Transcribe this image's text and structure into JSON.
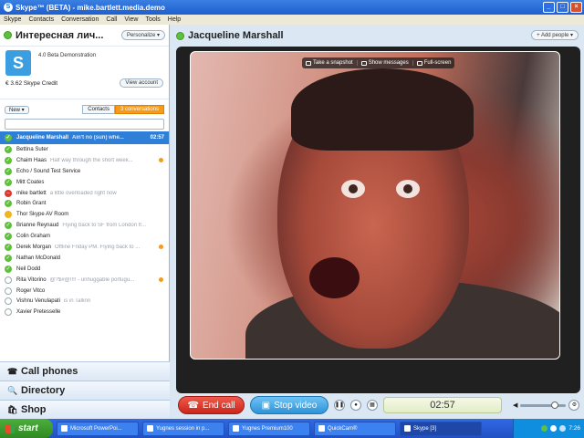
{
  "window": {
    "title": "Skype™ (BETA) - mike.bartlett.media.demo",
    "app_icon": "S",
    "controls": {
      "minimize": "_",
      "maximize": "□",
      "close": "×"
    }
  },
  "menu": [
    "Skype",
    "Contacts",
    "Conversation",
    "Call",
    "View",
    "Tools",
    "Help"
  ],
  "status": {
    "name": "Интересная лич...",
    "personalize_label": "Personalize ▾"
  },
  "profile": {
    "avatar_letter": "S",
    "mood": "4.0 Beta Demonstration",
    "credit": "€ 3.62 Skype Credit",
    "view_account_label": "View account"
  },
  "list_controls": {
    "new_label": "New ▾",
    "tab_contacts": "Contacts",
    "tab_conversations": "3 conversations"
  },
  "contacts": [
    {
      "name": "Jacqueline Marshall",
      "mood": "Ain't no (sun) whe...",
      "time": "02:57",
      "status": "online",
      "selected": true
    },
    {
      "name": "Bettina Suter",
      "mood": "",
      "status": "online"
    },
    {
      "name": "Chaim Haas",
      "mood": "Half way through the short week...",
      "status": "online",
      "flag": true
    },
    {
      "name": "Echo / Sound Test Service",
      "mood": "",
      "status": "online"
    },
    {
      "name": "Mitt Coates",
      "mood": "",
      "status": "online"
    },
    {
      "name": "mike bartlett",
      "mood": "a little overloaded right now",
      "status": "busy"
    },
    {
      "name": "Robin Grant",
      "mood": "",
      "status": "online"
    },
    {
      "name": "Thor Skype AV Room",
      "mood": "",
      "status": "away"
    },
    {
      "name": "Brianne Reynaud",
      "mood": "Flying back to SF from London fr...",
      "status": "online"
    },
    {
      "name": "Colin Graham",
      "mood": "",
      "status": "online"
    },
    {
      "name": "Derek Morgan",
      "mood": "Offline Friday PM. Flying back to ...",
      "status": "online",
      "flag": true
    },
    {
      "name": "Nathan McDonald",
      "mood": "",
      "status": "online"
    },
    {
      "name": "Neil Dodd",
      "mood": "",
      "status": "online"
    },
    {
      "name": "Rita Vitorino",
      "mood": "@?$#@!!!! - unhuggable portugu...",
      "status": "offline",
      "flag": true
    },
    {
      "name": "Roger Vitco",
      "mood": "",
      "status": "offline"
    },
    {
      "name": "Vishnu Venulapati",
      "mood": "is in Tallinn",
      "status": "offline"
    },
    {
      "name": "Xavier Pretesselle",
      "mood": "",
      "status": "offline"
    }
  ],
  "bottom_nav": [
    {
      "label": "Call phones",
      "icon": "phone-icon",
      "glyph": "☎"
    },
    {
      "label": "Directory",
      "icon": "search-icon",
      "glyph": "🔍"
    },
    {
      "label": "Shop",
      "icon": "shop-icon",
      "glyph": "🛍"
    }
  ],
  "conversation": {
    "name": "Jacqueline Marshall",
    "add_people_label": "+ Add people ▾"
  },
  "video_toolbar": {
    "snapshot": "Take a snapshot",
    "show_messages": "Show messages",
    "fullscreen": "Full-screen"
  },
  "call_controls": {
    "end_call": "End call",
    "stop_video": "Stop video",
    "timer": "02:57",
    "volume": 0.8
  },
  "taskbar": {
    "start": "start",
    "tasks": [
      {
        "label": "Microsoft PowerPoi...",
        "active": false
      },
      {
        "label": "Yugnes session in p...",
        "active": false
      },
      {
        "label": "Yugnes Premium100",
        "active": false
      },
      {
        "label": "QuickCam®",
        "active": false
      },
      {
        "label": "Skype [3]",
        "active": true
      }
    ],
    "clock": "7:26"
  },
  "colors": {
    "accent_orange": "#f59a1b",
    "selection_blue": "#2f7fd9",
    "online_green": "#5ec03b",
    "busy_red": "#d93a2b",
    "end_call_red": "#d9301f",
    "stop_video_blue": "#2e93d8"
  }
}
